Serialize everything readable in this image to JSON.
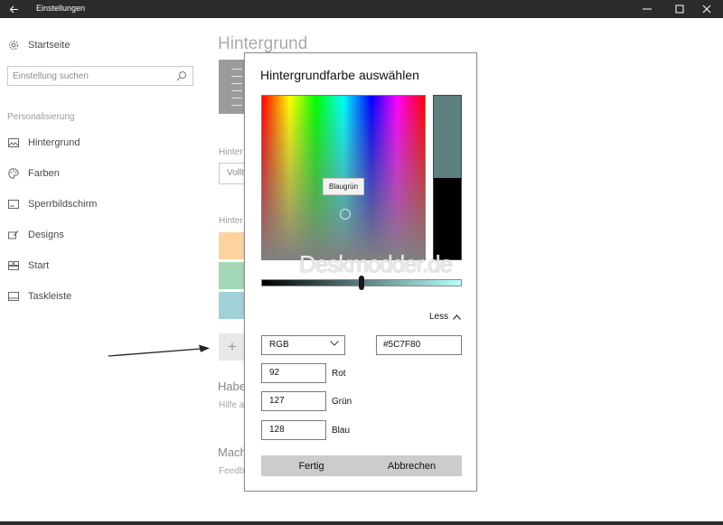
{
  "window": {
    "title": "Einstellungen",
    "back_icon": "arrow-left-icon",
    "controls": [
      "minimize-icon",
      "maximize-icon",
      "close-icon"
    ]
  },
  "sidebar": {
    "home_label": "Startseite",
    "search_placeholder": "Einstellung suchen",
    "section": "Personalisierung",
    "items": [
      {
        "label": "Hintergrund",
        "icon": "picture-icon"
      },
      {
        "label": "Farben",
        "icon": "palette-icon"
      },
      {
        "label": "Sperrbildschirm",
        "icon": "lockscreen-icon"
      },
      {
        "label": "Designs",
        "icon": "brush-icon"
      },
      {
        "label": "Start",
        "icon": "start-grid-icon"
      },
      {
        "label": "Taskleiste",
        "icon": "taskbar-icon"
      }
    ]
  },
  "main": {
    "title": "Hintergrund",
    "label_1": "Hinter",
    "select_value": "Vollt",
    "label_2": "Hinter",
    "swatch_colors": [
      "#ffd3a0",
      "#a3d6b4",
      "#9fd1d6"
    ],
    "add_symbol": "+",
    "help_heading": "Habe",
    "help_sub": "Hilfe a",
    "make_heading": "Mach",
    "make_sub": "Feedb"
  },
  "dialog": {
    "title": "Hintergrundfarbe auswählen",
    "tooltip": "Blaugrün",
    "watermark": "Deskmodder.de",
    "less_label": "Less",
    "mode_select": "RGB",
    "hex_value": "#5C7F80",
    "fields": [
      {
        "value": "92",
        "label": "Rot"
      },
      {
        "value": "127",
        "label": "Grün"
      },
      {
        "value": "128",
        "label": "Blau"
      }
    ],
    "ok_button": "Fertig",
    "cancel_button": "Abbrechen",
    "colors": {
      "new": "#5c7f80",
      "old": "#000000"
    }
  }
}
